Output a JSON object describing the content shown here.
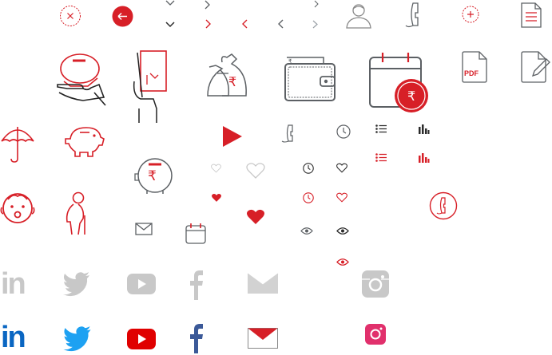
{
  "labels": {
    "rupee": "₹",
    "pdf": "PDF",
    "linkedin": "in"
  },
  "colors": {
    "red": "#d71f27",
    "dark_gray": "#5c6064",
    "light_gray": "#c8c8c8",
    "linkedin_blue": "#0a66c2",
    "twitter_blue": "#1da1f2",
    "youtube_red": "#e00000",
    "facebook_blue": "#3b5998",
    "instagram_pink": "#e1306c"
  },
  "icons": [
    "close-circle-icon",
    "back-arrow-circle-icon",
    "chevron-down-icon",
    "chevron-right-icon",
    "user-icon",
    "phone-icon",
    "plus-circle-icon",
    "document-icon",
    "piggy-bank-hand-icon",
    "hand-holding-invoice-icon",
    "money-bags-icon",
    "wallet-icon",
    "calendar-rupee-icon",
    "pdf-file-icon",
    "edit-file-icon",
    "umbrella-icon",
    "piggy-bank-icon",
    "play-icon",
    "list-icon",
    "bar-chart-icon",
    "rupee-piggy-icon",
    "heart-icon",
    "clock-icon",
    "eye-icon",
    "mail-icon",
    "calendar-icon",
    "baby-icon",
    "elderly-person-icon",
    "linkedin-icon",
    "twitter-icon",
    "youtube-icon",
    "facebook-icon",
    "instagram-icon"
  ]
}
